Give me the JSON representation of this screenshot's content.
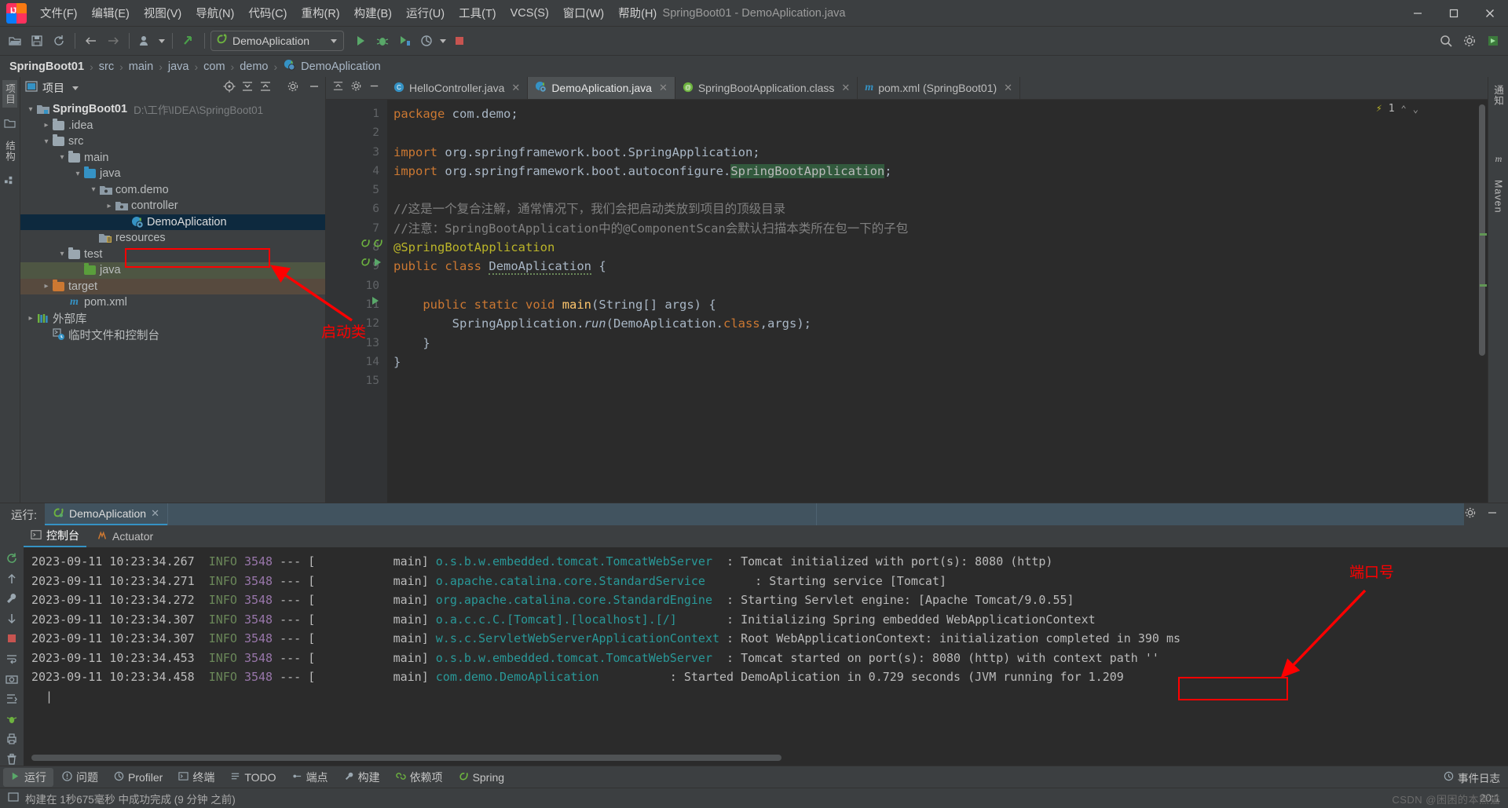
{
  "window": {
    "title": "SpringBoot01 - DemoAplication.java",
    "minimize": "—",
    "maximize": "▢",
    "close": "✕"
  },
  "menu": [
    {
      "label": "文件(F)",
      "name": "menu-file"
    },
    {
      "label": "编辑(E)",
      "name": "menu-edit"
    },
    {
      "label": "视图(V)",
      "name": "menu-view"
    },
    {
      "label": "导航(N)",
      "name": "menu-navigate"
    },
    {
      "label": "代码(C)",
      "name": "menu-code"
    },
    {
      "label": "重构(R)",
      "name": "menu-refactor"
    },
    {
      "label": "构建(B)",
      "name": "menu-build"
    },
    {
      "label": "运行(U)",
      "name": "menu-run"
    },
    {
      "label": "工具(T)",
      "name": "menu-tools"
    },
    {
      "label": "VCS(S)",
      "name": "menu-vcs"
    },
    {
      "label": "窗口(W)",
      "name": "menu-window"
    },
    {
      "label": "帮助(H)",
      "name": "menu-help"
    }
  ],
  "toolbar": {
    "run_configuration": "DemoAplication",
    "icons": [
      "open-folder-icon",
      "save-icon",
      "sync-icon",
      "back-arrow-icon",
      "forward-arrow-icon",
      "user-avatar-icon",
      "update-project-icon"
    ],
    "run_icons": [
      "run-icon",
      "debug-icon",
      "run-with-coverage-icon",
      "profiler-icon",
      "stop-icon"
    ],
    "right_icons": [
      "search-icon",
      "settings-gear-icon",
      "ide-badge-icon"
    ]
  },
  "breadcrumb": {
    "items": [
      "SpringBoot01",
      "src",
      "main",
      "java",
      "com",
      "demo",
      "DemoAplication"
    ],
    "separator": "›"
  },
  "left_strip": {
    "project_label": "项目",
    "structure_label": "结构",
    "icons": [
      "project-tool-icon",
      "commit-tool-icon",
      "structure-tool-icon",
      "bean-validation-icon"
    ]
  },
  "right_strip": {
    "notifications_label": "通知",
    "maven_label": "Maven"
  },
  "project_panel": {
    "title": "项目",
    "tools": [
      "locate-file-icon",
      "expand-all-icon",
      "collapse-all-icon",
      "settings-gear-icon",
      "hide-icon"
    ],
    "tree": [
      {
        "label": "SpringBoot01",
        "path": "D:\\工作\\IDEA\\SpringBoot01",
        "depth": 0,
        "arrow": "expanded",
        "icon": "module-folder-icon",
        "bold": true,
        "state": "normal"
      },
      {
        "label": ".idea",
        "path": "",
        "depth": 1,
        "arrow": "collapsed",
        "icon": "folder-icon",
        "bold": false,
        "state": "normal"
      },
      {
        "label": "src",
        "path": "",
        "depth": 1,
        "arrow": "expanded",
        "icon": "folder-icon",
        "bold": false,
        "state": "normal"
      },
      {
        "label": "main",
        "path": "",
        "depth": 2,
        "arrow": "expanded",
        "icon": "folder-icon",
        "bold": false,
        "state": "normal"
      },
      {
        "label": "java",
        "path": "",
        "depth": 3,
        "arrow": "expanded",
        "icon": "source-folder-icon",
        "bold": false,
        "state": "normal"
      },
      {
        "label": "com.demo",
        "path": "",
        "depth": 4,
        "arrow": "expanded",
        "icon": "package-icon",
        "bold": false,
        "state": "normal"
      },
      {
        "label": "controller",
        "path": "",
        "depth": 5,
        "arrow": "collapsed",
        "icon": "package-icon",
        "bold": false,
        "state": "normal"
      },
      {
        "label": "DemoAplication",
        "path": "",
        "depth": 6,
        "arrow": "none",
        "icon": "spring-class-icon",
        "bold": false,
        "state": "selected"
      },
      {
        "label": "resources",
        "path": "",
        "depth": 4,
        "arrow": "none",
        "icon": "resources-folder-icon",
        "bold": false,
        "state": "normal"
      },
      {
        "label": "test",
        "path": "",
        "depth": 3,
        "arrow": "expanded",
        "icon": "folder-icon",
        "bold": false,
        "state": "normal"
      },
      {
        "label": "java",
        "path": "",
        "depth": 4,
        "arrow": "none",
        "icon": "test-source-folder-icon",
        "bold": false,
        "state": "green"
      },
      {
        "label": "target",
        "path": "",
        "depth": 2,
        "arrow": "collapsed",
        "icon": "excluded-folder-icon",
        "bold": false,
        "state": "brown"
      },
      {
        "label": "pom.xml",
        "path": "",
        "depth": 2,
        "arrow": "none",
        "icon": "maven-icon",
        "bold": false,
        "state": "normal"
      },
      {
        "label": "外部库",
        "path": "",
        "depth": 0,
        "arrow": "collapsed",
        "icon": "library-icon",
        "bold": false,
        "state": "normal"
      },
      {
        "label": "临时文件和控制台",
        "path": "",
        "depth": 0,
        "arrow": "none",
        "icon": "scratches-icon",
        "bold": false,
        "state": "normal"
      }
    ]
  },
  "editor": {
    "tabs": [
      {
        "label": "HelloController.java",
        "icon": "java-class-icon",
        "active": false,
        "close": "✕"
      },
      {
        "label": "DemoAplication.java",
        "icon": "spring-class-icon",
        "active": true,
        "close": "✕"
      },
      {
        "label": "SpringBootApplication.class",
        "icon": "annotation-class-icon",
        "active": false,
        "close": "✕"
      },
      {
        "label": "pom.xml (SpringBoot01)",
        "icon": "maven-icon",
        "active": false,
        "close": "✕"
      }
    ],
    "inspection_count": "1",
    "line_numbers": [
      "1",
      "2",
      "3",
      "4",
      "5",
      "6",
      "7",
      "8",
      "9",
      "10",
      "11",
      "12",
      "13",
      "14",
      "15"
    ],
    "lines": [
      "package com.demo;",
      "",
      "import org.springframework.boot.SpringApplication;",
      "import org.springframework.boot.autoconfigure.SpringBootApplication;",
      "",
      "//这是一个复合注解，通常情况下，我们会把启动类放到项目的顶级目录",
      "//注意：SpringBootApplication中的@ComponentScan会默认扫描本类所在包一下的子包",
      "@SpringBootApplication",
      "public class DemoAplication {",
      "",
      "    public static void main(String[] args) {",
      "        SpringApplication.run(DemoAplication.class,args);",
      "    }",
      "}",
      ""
    ]
  },
  "run_panel": {
    "run_label": "运行:",
    "tab_label": "DemoAplication",
    "tab_close": "✕",
    "subtabs": [
      {
        "label": "控制台",
        "icon": "console-icon",
        "active": true
      },
      {
        "label": "Actuator",
        "icon": "actuator-icon",
        "active": false
      }
    ],
    "header_icons": [
      "settings-gear-icon",
      "hide-panel-icon"
    ],
    "side_icons": [
      "rerun-icon",
      "wrench-icon",
      "stop-icon",
      "camera-icon",
      "thread-dump-icon",
      "print-icon",
      "trash-icon",
      "scroll-up-icon",
      "scroll-down-icon",
      "soft-wrap-icon",
      "scroll-to-end-icon"
    ],
    "log_lines": [
      {
        "date": "2023-09-11 10:23:34.267",
        "level": "INFO",
        "pid": "3548",
        "dash": "---",
        "thread": "main",
        "logger": "o.s.b.w.embedded.tomcat.TomcatWebServer",
        "message": "Tomcat initialized with port(s): 8080 (http)"
      },
      {
        "date": "2023-09-11 10:23:34.271",
        "level": "INFO",
        "pid": "3548",
        "dash": "---",
        "thread": "main",
        "logger": "o.apache.catalina.core.StandardService",
        "message": "Starting service [Tomcat]"
      },
      {
        "date": "2023-09-11 10:23:34.272",
        "level": "INFO",
        "pid": "3548",
        "dash": "---",
        "thread": "main",
        "logger": "org.apache.catalina.core.StandardEngine",
        "message": "Starting Servlet engine: [Apache Tomcat/9.0.55]"
      },
      {
        "date": "2023-09-11 10:23:34.307",
        "level": "INFO",
        "pid": "3548",
        "dash": "---",
        "thread": "main",
        "logger": "o.a.c.c.C.[Tomcat].[localhost].[/]",
        "message": "Initializing Spring embedded WebApplicationContext"
      },
      {
        "date": "2023-09-11 10:23:34.307",
        "level": "INFO",
        "pid": "3548",
        "dash": "---",
        "thread": "main",
        "logger": "w.s.c.ServletWebServerApplicationContext",
        "message": "Root WebApplicationContext: initialization completed in 390 ms"
      },
      {
        "date": "2023-09-11 10:23:34.453",
        "level": "INFO",
        "pid": "3548",
        "dash": "---",
        "thread": "main",
        "logger": "o.s.b.w.embedded.tomcat.TomcatWebServer",
        "message": "Tomcat started on port(s): 8080 (http) with context path ''"
      },
      {
        "date": "2023-09-11 10:23:34.458",
        "level": "INFO",
        "pid": "3548",
        "dash": "---",
        "thread": "main",
        "logger": "com.demo.DemoAplication",
        "message": "Started DemoAplication in 0.729 seconds (JVM running for 1.209"
      }
    ]
  },
  "bottom_bar": {
    "items": [
      {
        "label": "运行",
        "icon": "run-icon",
        "active": true
      },
      {
        "label": "问题",
        "icon": "problems-icon",
        "active": false
      },
      {
        "label": "Profiler",
        "icon": "profiler-icon",
        "active": false
      },
      {
        "label": "终端",
        "icon": "terminal-icon",
        "active": false
      },
      {
        "label": "TODO",
        "icon": "todo-icon",
        "active": false
      },
      {
        "label": "端点",
        "icon": "endpoints-icon",
        "active": false
      },
      {
        "label": "构建",
        "icon": "build-icon",
        "active": false
      },
      {
        "label": "依赖项",
        "icon": "dependencies-icon",
        "active": false
      },
      {
        "label": "Spring",
        "icon": "spring-icon",
        "active": false
      }
    ],
    "event_log": "事件日志"
  },
  "status_bar": {
    "message": "构建在 1秒675毫秒 中成功完成 (9 分钟 之前)",
    "caret_position": "20:1",
    "watermark": "CSDN @困困的本熊猫"
  },
  "annotations": {
    "startup_class_label": "启动类",
    "port_label": "端口号",
    "box_color": "#ff0000"
  },
  "colors": {
    "bg": "#3c3f41",
    "editor_bg": "#2b2b2b",
    "gutter": "#313335",
    "selection": "#0d293e",
    "accent": "#3592c4",
    "keyword": "#cc7832",
    "string": "#6a8759",
    "annotation": "#bbb529",
    "comment": "#808080",
    "logger": "#299999",
    "pid": "#9876aa"
  }
}
